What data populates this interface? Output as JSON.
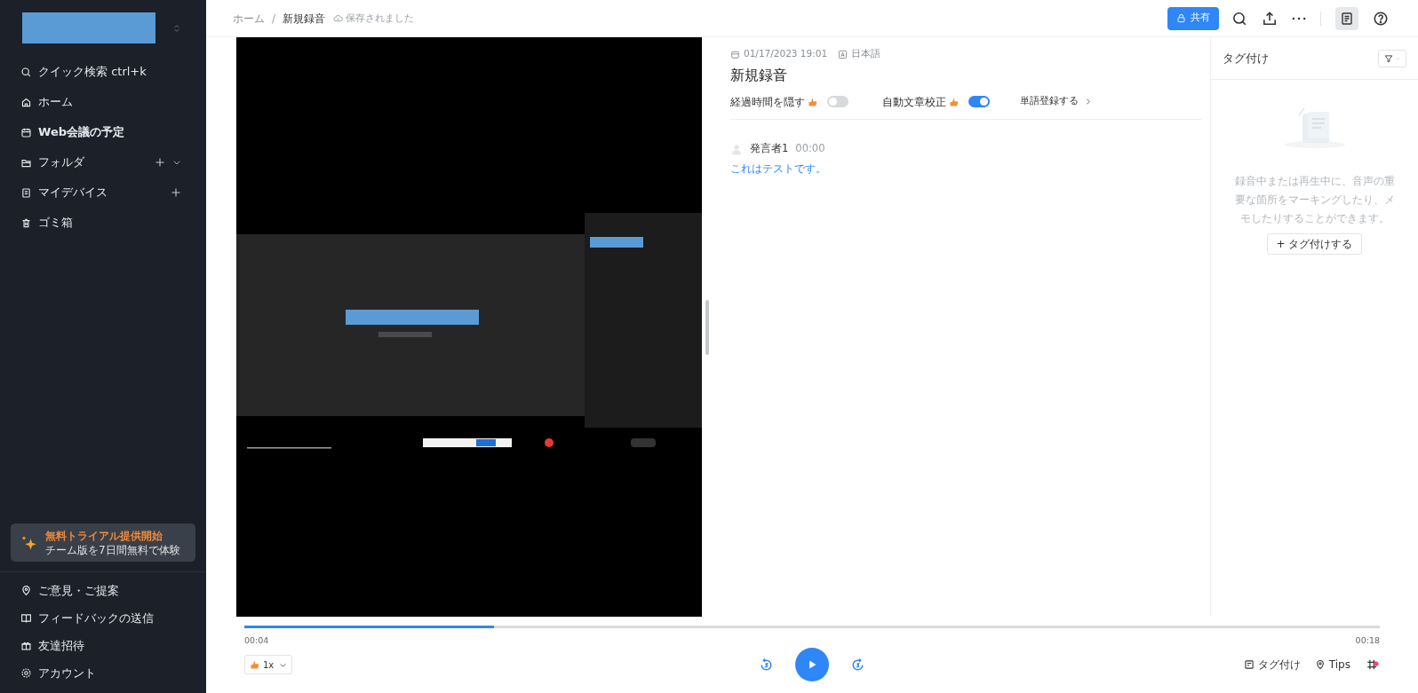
{
  "sidebar": {
    "items": [
      {
        "label": "クイック検索 ctrl+k",
        "bold": false,
        "add": false,
        "expand": false
      },
      {
        "label": "ホーム",
        "bold": false,
        "add": false,
        "expand": false
      },
      {
        "label": "Web会議の予定",
        "bold": true,
        "add": false,
        "expand": false
      },
      {
        "label": "フォルダ",
        "bold": false,
        "add": true,
        "expand": true
      },
      {
        "label": "マイデバイス",
        "bold": false,
        "add": true,
        "expand": false
      },
      {
        "label": "ゴミ箱",
        "bold": false,
        "add": false,
        "expand": false
      }
    ],
    "trial": {
      "title": "無料トライアル提供開始",
      "subtitle": "チーム版を7日間無料で体験"
    },
    "footer_items": [
      {
        "label": "ご意見・ご提案"
      },
      {
        "label": "フィードバックの送信"
      },
      {
        "label": "友達招待"
      },
      {
        "label": "アカウント"
      }
    ]
  },
  "breadcrumb": {
    "items": [
      "ホーム",
      "新規録音"
    ],
    "separator": "/",
    "status": "保存されました"
  },
  "toolbar": {
    "share": "共有"
  },
  "recording": {
    "date": "01/17/2023 19:01",
    "language": "日本語",
    "title": "新規録音",
    "toggles": [
      {
        "label": "経過時間を隠す",
        "on": false
      },
      {
        "label": "自動文章校正",
        "on": true
      }
    ],
    "link": "単語登録する",
    "segments": [
      {
        "speaker": "発言者1",
        "time": "00:00",
        "text": "これはテストです。"
      }
    ]
  },
  "tags_panel": {
    "title": "タグ付け",
    "empty_text": "録音中または再生中に、音声の重要な箇所をマーキングしたり、メモしたりすることができます。",
    "button": "+ タグ付けする"
  },
  "player": {
    "elapsed": "00:04",
    "total": "00:18",
    "level": 0.22,
    "speed": "1x",
    "tag_button": "タグ付け",
    "tips": "Tips"
  }
}
